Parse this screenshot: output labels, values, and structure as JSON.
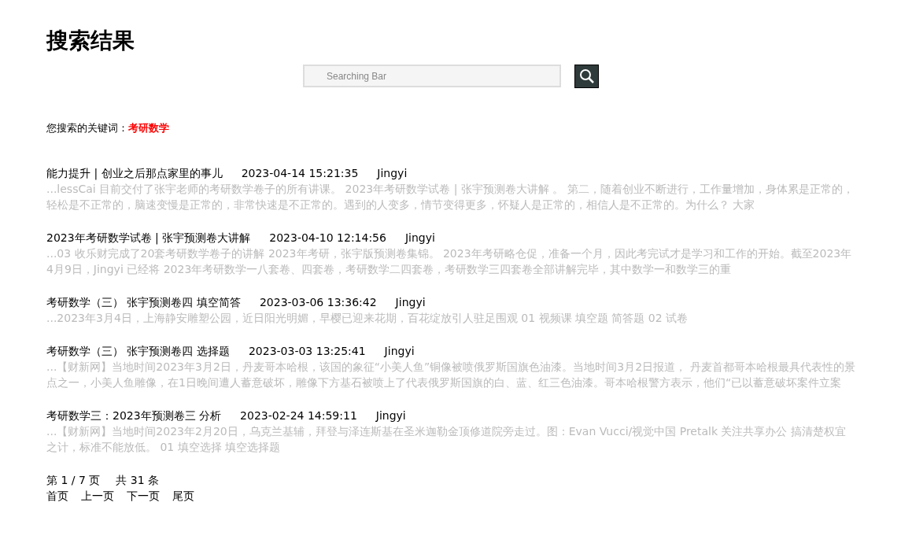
{
  "title": "搜索结果",
  "search": {
    "placeholder": "Searching Bar"
  },
  "keyword": {
    "label": "您搜索的关键词：",
    "value": "考研数学"
  },
  "results": [
    {
      "title": "能力提升 | 创业之后那点家里的事儿",
      "date": "2023-04-14 15:21:35",
      "author": "Jingyi",
      "snippet": "...lessCai 目前交付了张宇老师的考研数学卷子的所有讲课。 2023年考研数学试卷 | 张宇预测卷大讲解 。 第二，随着创业不断进行，工作量增加，身体累是正常的，轻松是不正常的，脑速变慢是正常的，非常快速是不正常的。遇到的人变多，情节变得更多，怀疑人是正常的，相信人是不正常的。为什么？ 大家"
    },
    {
      "title": "2023年考研数学试卷 | 张宇预测卷大讲解",
      "date": "2023-04-10 12:14:56",
      "author": "Jingyi",
      "snippet": "...03 收乐财完成了20套考研数学卷子的讲解 2023年考研，张宇版预测卷集锦。 2023年考研略仓促，准备一个月，因此考完试才是学习和工作的开始。截至2023年4月9日，Jingyi 已经将 2023年考研数学一八套卷、四套卷，考研数学二四套卷，考研数学三四套卷全部讲解完毕，其中数学一和数学三的重"
    },
    {
      "title": "考研数学（三） 张宇预测卷四 填空简答",
      "date": "2023-03-06 13:36:42",
      "author": "Jingyi",
      "snippet": "...2023年3月4日，上海静安雕塑公园，近日阳光明媚，早樱已迎来花期，百花绽放引人驻足围观 01 视频课 填空题 简答题 02 试卷"
    },
    {
      "title": "考研数学（三） 张宇预测卷四 选择题",
      "date": "2023-03-03 13:25:41",
      "author": "Jingyi",
      "snippet": "...【财新网】当地时间2023年3月2日，丹麦哥本哈根，该国的象征“小美人鱼”铜像被喷俄罗斯国旗色油漆。当地时间3月2日报道， 丹麦首都哥本哈根最具代表性的景点之一，小美人鱼雕像，在1日晚间遭人蓄意破坏，雕像下方基石被喷上了代表俄罗斯国旗的白、蓝、红三色油漆。哥本哈根警方表示，他们“已以蓄意破坏案件立案"
    },
    {
      "title": "考研数学三：2023年预测卷三 分析",
      "date": "2023-02-24 14:59:11",
      "author": "Jingyi",
      "snippet": "...【财新网】当地时间2023年2月20日，乌克兰基辅，拜登与泽连斯基在圣米迦勒金顶修道院旁走过。图：Evan Vucci/视觉中国 Pretalk 关注共享办公 搞清楚权宜之计，标准不能放低。 01 填空选择 填空选择题"
    }
  ],
  "pagination": {
    "page": "第 1 / 7 页",
    "total": "共 31 条",
    "links": [
      "首页",
      "上一页",
      "下一页",
      "尾页"
    ]
  }
}
